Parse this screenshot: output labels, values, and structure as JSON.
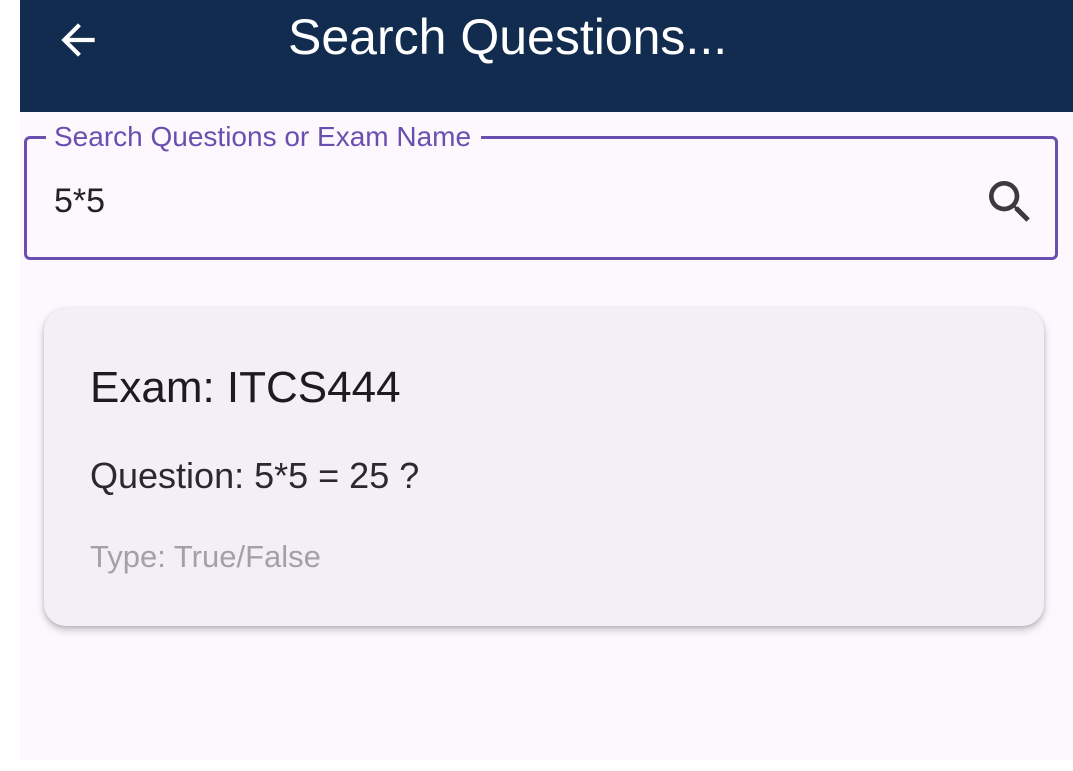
{
  "app_bar": {
    "title": "Search Questions...",
    "back_icon": "arrow-left-icon",
    "background_color": "#112c4f"
  },
  "search": {
    "label": "Search Questions or Exam Name",
    "value": "5*5",
    "icon": "search-icon",
    "accent_color": "#6a4fae"
  },
  "results": [
    {
      "exam": "Exam: ITCS444",
      "question": "Question: 5*5 = 25 ?",
      "type": "Type: True/False"
    }
  ]
}
